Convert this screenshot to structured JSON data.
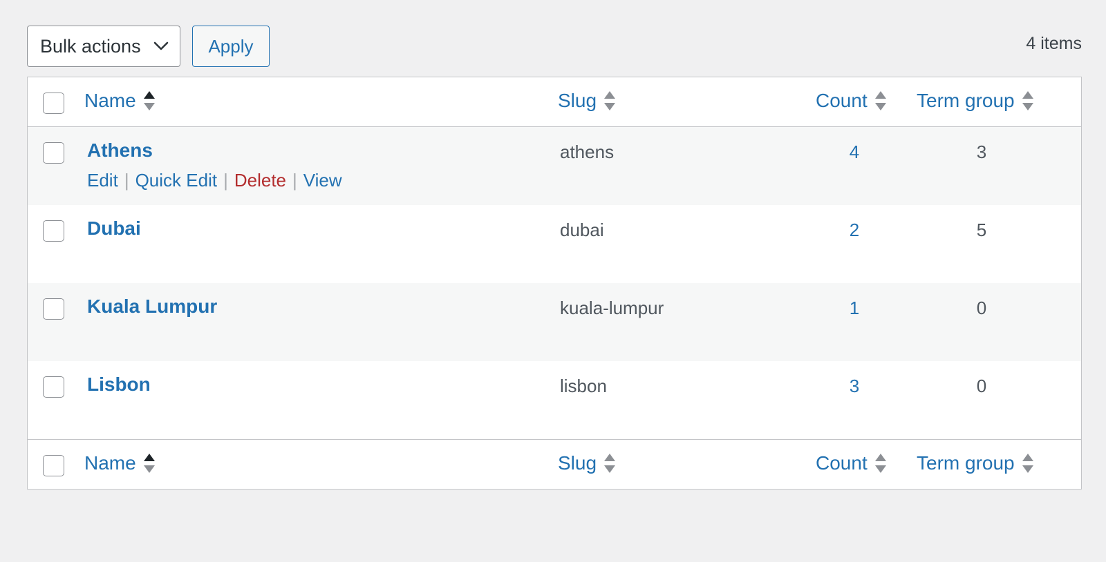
{
  "toolbar": {
    "bulk_actions_label": "Bulk actions",
    "apply_label": "Apply",
    "items_count": "4 items"
  },
  "columns": {
    "name": "Name",
    "slug": "Slug",
    "count": "Count",
    "term_group": "Term group",
    "sorted_by": "name",
    "sort_direction": "asc"
  },
  "row_actions": {
    "edit": "Edit",
    "quick_edit": "Quick Edit",
    "delete": "Delete",
    "view": "View",
    "separator": "|"
  },
  "rows": [
    {
      "name": "Athens",
      "slug": "athens",
      "count": "4",
      "term_group": "3"
    },
    {
      "name": "Dubai",
      "slug": "dubai",
      "count": "2",
      "term_group": "5"
    },
    {
      "name": "Kuala Lumpur",
      "slug": "kuala-lumpur",
      "count": "1",
      "term_group": "0"
    },
    {
      "name": "Lisbon",
      "slug": "lisbon",
      "count": "3",
      "term_group": "0"
    }
  ],
  "colors": {
    "link": "#2271b1",
    "delete": "#b32d2e",
    "background": "#f0f0f1",
    "alt_row": "#f6f7f7"
  }
}
